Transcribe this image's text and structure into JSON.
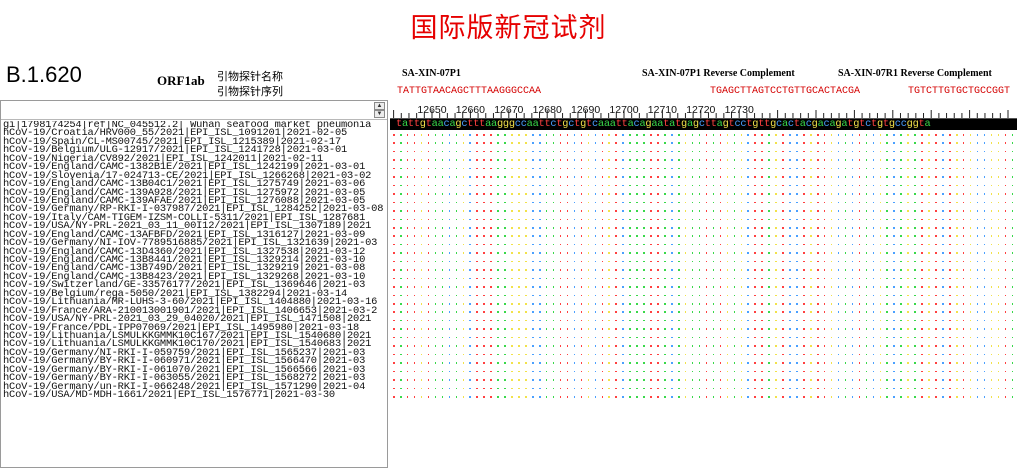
{
  "slide": {
    "title": "国际版新冠试剂",
    "lineage": "B.1.620",
    "gene": "ORF1ab",
    "probe_name_label": "引物探针名称",
    "probe_seq_label": "引物探针序列"
  },
  "probes": [
    {
      "name": "SA-XIN-07P1",
      "sequence": "TATTGTAACAGCTTTAAGGGCCAA"
    },
    {
      "name": "SA-XIN-07P1 Reverse Complement",
      "sequence": "TGAGCTTAGTCCTGTTGCACTACGA"
    },
    {
      "name": "SA-XIN-07R1 Reverse Complement",
      "sequence": "TGTCTTGTGCTGCCGGT"
    }
  ],
  "ruler": {
    "ticks": [
      "12650",
      "12660",
      "12670",
      "12680",
      "12690",
      "12700",
      "12710",
      "12720",
      "12730"
    ]
  },
  "reference_sequence": "tattgtaacagctttaagggccaattctgctgtcaaattacagaatatgagcttagtcctgttgcactacgacagatgtctgtgccggta",
  "base_colors": {
    "a": "#39d84a",
    "t": "#ff4040",
    "g": "#f2e24a",
    "c": "#4aa0ff"
  },
  "dot_color_order": [
    "t",
    "a",
    "t",
    "t",
    "g",
    "t",
    "a",
    "a",
    "c",
    "a",
    "g",
    "c",
    "t",
    "t",
    "t",
    "a",
    "a",
    "g",
    "g",
    "g",
    "c",
    "c",
    "a",
    "a",
    "t",
    "t",
    "c",
    "t",
    "g",
    "c",
    "t",
    "g",
    "t",
    "c",
    "a",
    "a",
    "a",
    "t",
    "t",
    "a",
    "c",
    "a",
    "g",
    "a",
    "a",
    "t",
    "a",
    "t",
    "g",
    "a",
    "g",
    "c",
    "t",
    "t",
    "a",
    "g",
    "t",
    "c",
    "c",
    "t",
    "g",
    "t",
    "t",
    "g",
    "c",
    "a",
    "c",
    "t",
    "a",
    "c",
    "g",
    "a",
    "c",
    "a",
    "g",
    "a",
    "t",
    "g",
    "t",
    "c",
    "t",
    "g",
    "t",
    "g",
    "c",
    "c",
    "g",
    "g",
    "t",
    "a"
  ],
  "sequences": [
    "gi|1798174254|ref|NC_045512.2| Wuhan seafood market pneumonia",
    "hCoV-19/Croatia/HRV000_55/2021|EPI_ISL_1091201|2021-02-05",
    "hCoV-19/Spain/CL-MS00745/2021|EPI_ISL_1215389|2021-02-17",
    "hCoV-19/Belgium/ULG-12917/2021|EPI_ISL_1241728|2021-03-01",
    "hCoV-19/Nigeria/CV892/2021|EPI_ISL_1242011|2021-02-11",
    "hCoV-19/England/CAMC-1382B1E/2021|EPI_ISL_1242199|2021-03-01",
    "hCoV-19/Slovenia/17-024713-CE/2021|EPI_ISL_1266268|2021-03-02",
    "hCoV-19/England/CAMC-13B04C1/2021|EPI_ISL_1275749|2021-03-06",
    "hCoV-19/England/CAMC-139A928/2021|EPI_ISL_1275972|2021-03-05",
    "hCoV-19/England/CAMC-139AFAE/2021|EPI_ISL_1276088|2021-03-05",
    "hCoV-19/Germany/RP-RKI-I-037987/2021|EPI_ISL_1284252|2021-03-08",
    "hCoV-19/Italy/CAM-TIGEM-IZSM-COLLI-5311/2021|EPI_ISL_1287681",
    "hCoV-19/USA/NY-PRL-2021_03_11_00I12/2021|EPI_ISL_1307189|2021",
    "hCoV-19/England/CAMC-13AFBFD/2021|EPI_ISL_1316127|2021-03-09",
    "hCoV-19/Germany/NI-IOV-7789516885/2021|EPI_ISL_1321639|2021-03",
    "hCoV-19/England/CAMC-13D4360/2021|EPI_ISL_1327538|2021-03-12",
    "hCoV-19/England/CAMC-13B8441/2021|EPI_ISL_1329214|2021-03-10",
    "hCoV-19/England/CAMC-13B749D/2021|EPI_ISL_1329219|2021-03-08",
    "hCoV-19/England/CAMC-13B8423/2021|EPI_ISL_1329268|2021-03-10",
    "hCoV-19/Switzerland/GE-33576177/2021|EPI_ISL_1369646|2021-03",
    "hCoV-19/Belgium/rega-5050/2021|EPI_ISL_1382294|2021-03-14",
    "hCoV-19/Lithuania/MR-LUHS-3-60/2021|EPI_ISL_1404880|2021-03-16",
    "hCoV-19/France/ARA-210013001901/2021|EPI_ISL_1406653|2021-03-2",
    "hCoV-19/USA/NY-PRL-2021_03_29_04020/2021|EPI_ISL_1471508|2021",
    "hCoV-19/France/PDL-IPP07069/2021|EPI_ISL_1495980|2021-03-18",
    "hCoV-19/Lithuania/LSMULKKGMMK10C167/2021|EPI_ISL_1540680|2021",
    "hCoV-19/Lithuania/LSMULKKGMMK10C170/2021|EPI_ISL_1540683|2021",
    "hCoV-19/Germany/NI-RKI-I-059759/2021|EPI_ISL_1565237|2021-03",
    "hCoV-19/Germany/BY-RKI-I-060971/2021|EPI_ISL_1566470|2021-03",
    "hCoV-19/Germany/BY-RKI-I-061070/2021|EPI_ISL_1566566|2021-03",
    "hCoV-19/Germany/BY-RKI-I-063055/2021|EPI_ISL_1568272|2021-03",
    "hCoV-19/Germany/un-RKI-I-066248/2021|EPI_ISL_1571290|2021-04",
    "hCoV-19/USA/MD-MDH-1661/2021|EPI_ISL_1576771|2021-03-30"
  ]
}
